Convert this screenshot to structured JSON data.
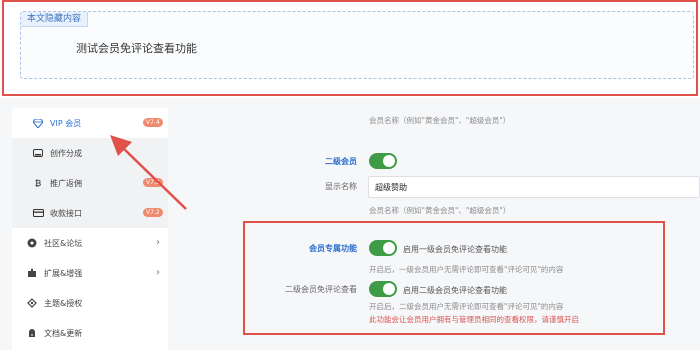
{
  "hidden_content": {
    "tag": "本文隐藏内容",
    "text": "测试会员免评论查看功能"
  },
  "sidebar": {
    "items": [
      {
        "label": "VIP 会员",
        "icon": "diamond-icon",
        "badge": "V7.4"
      },
      {
        "label": "创作分成",
        "icon": "wallet-icon",
        "badge": ""
      },
      {
        "label": "推广返佣",
        "icon": "bitcoin-icon",
        "badge": "V7.2"
      },
      {
        "label": "收款接口",
        "icon": "card-icon",
        "badge": "V7.2"
      },
      {
        "label": "社区&论坛",
        "icon": "community-icon",
        "chevron": "›"
      },
      {
        "label": "扩展&增强",
        "icon": "puzzle-icon",
        "chevron": "›"
      },
      {
        "label": "主题&授权",
        "icon": "theme-icon",
        "chevron": ""
      },
      {
        "label": "文档&更新",
        "icon": "doc-icon",
        "chevron": ""
      }
    ]
  },
  "form": {
    "member_name_hint_1": "会员名称（例如\"黄金会员\"、\"超级会员\"）",
    "level2_label": "二级会员",
    "level2_enabled": true,
    "display_name_label": "显示名称",
    "display_name_value": "超级赞助",
    "member_name_hint_2": "会员名称（例如\"黄金会员\"、\"超级会员\"）",
    "exclusive_label": "会员专属功能",
    "level1_toggle_label": "启用一级会员免评论查看功能",
    "level1_enabled": true,
    "level1_desc": "开启后，一级会员用户无需评论即可查看\"评论可见\"的内容",
    "level2_free_label": "二级会员免评论查看",
    "level2_toggle_label": "启用二级会员免评论查看功能",
    "level2_free_enabled": true,
    "level2_desc": "开启后，二级会员用户无需评论即可查看\"评论可见\"的内容",
    "warning": "此功能会让会员用户拥有与管理员相同的查看权限，请谨慎开启"
  },
  "colors": {
    "accent": "#2a6fd0",
    "toggle_on": "#3f9b45",
    "warning": "#d9534f",
    "highlight_frame": "#e0514a",
    "badge": "#f08a6e"
  }
}
